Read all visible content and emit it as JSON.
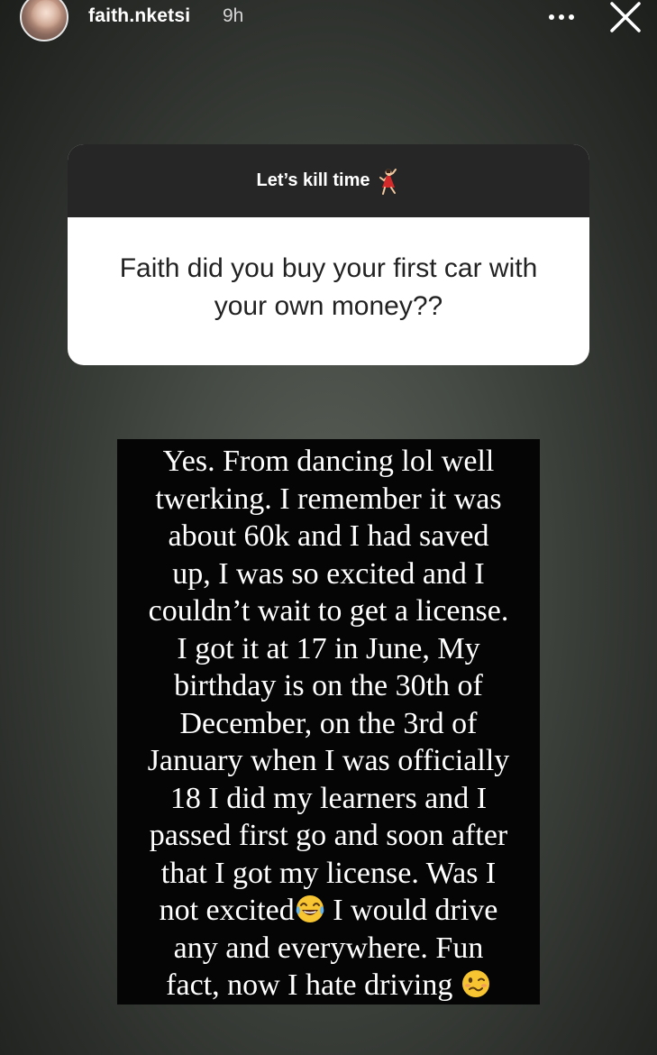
{
  "header": {
    "username": "faith.nketsi",
    "time": "9h",
    "icons": {
      "more": "more-horizontal-icon",
      "close": "close-icon"
    }
  },
  "question_sticker": {
    "prompt": "Let’s kill time",
    "prompt_emoji": "dancing-woman-emoji",
    "question": "Faith did you buy your first car with your own money??"
  },
  "answer": {
    "part1": "Yes. From dancing lol well\ntwerking. I remember it was\nabout 60k and I had saved\nup, I was so excited and I\ncouldn’t wait to get a license.\nI got it at 17 in June, My\nbirthday is on the 30th of\nDecember, on the 3rd of\nJanuary when I was officially\n18 I did my learners and I\npassed first go and soon after\nthat I got my license. Was I\nnot excited",
    "emoji1": "face-with-tears-of-joy-emoji",
    "part2": " I would drive\nany and everywhere. Fun\nfact, now I hate driving ",
    "emoji2": "woozy-face-emoji"
  },
  "colors": {
    "question_header_bg": "#262626",
    "question_body_bg": "#ffffff",
    "answer_bg": "#050505",
    "text_light": "#ffffff"
  }
}
